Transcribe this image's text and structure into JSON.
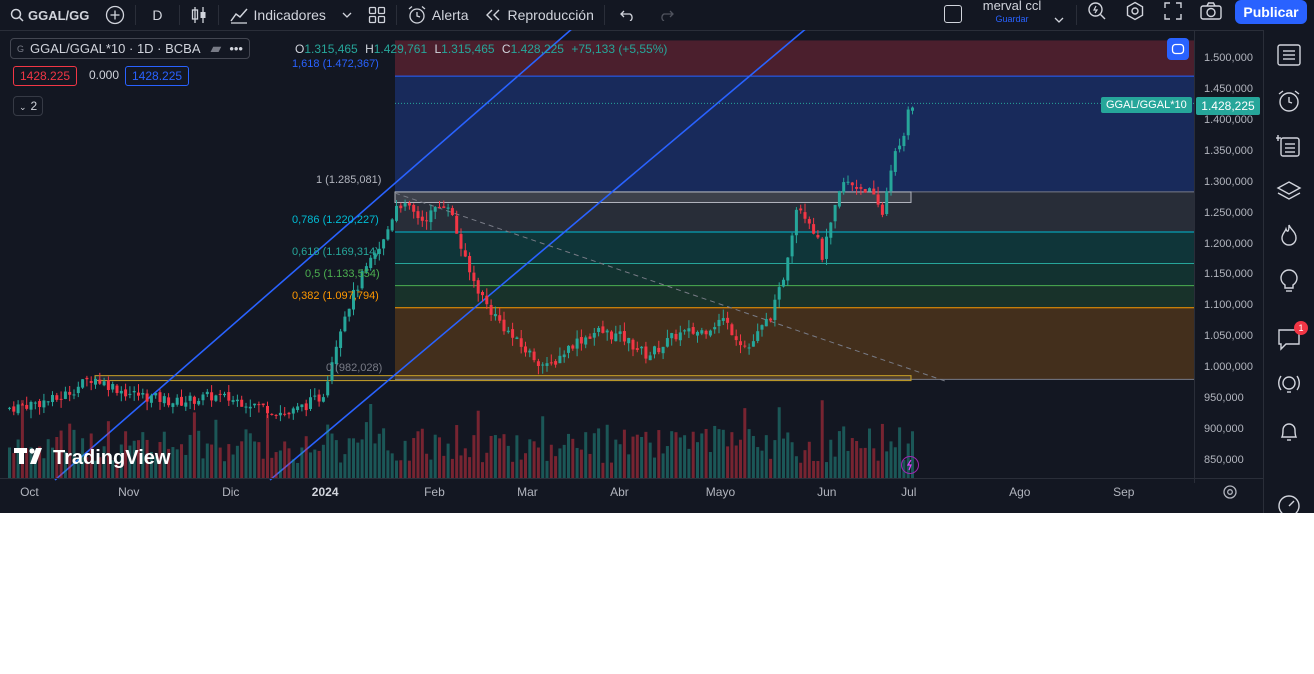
{
  "topbar": {
    "symbol": "GGAL/GG",
    "interval": "D",
    "indicators_label": "Indicadores",
    "alert_label": "Alerta",
    "replay_label": "Reproducción",
    "layout_name": "merval ccl",
    "layout_status": "Guardar",
    "publish_label": "Publicar"
  },
  "legend": {
    "symbol_full": "GGAL/GGAL*10 · 1D · BCBA",
    "bid": "1428.225",
    "spread": "0.000",
    "ask": "1428.225",
    "indicators_count": "2",
    "ohlc": {
      "o_label": "O",
      "o": "1.315,465",
      "h_label": "H",
      "h": "1.429,761",
      "l_label": "L",
      "l": "1.315,465",
      "c_label": "C",
      "c": "1.428,225",
      "change": "+75,133 (+5,55%)"
    }
  },
  "fib_labels": {
    "f1618": "1,618 (1.472,367)",
    "f1": "1 (1.285,081)",
    "f786": "0,786 (1.220,227)",
    "f618": "0,618 (1.169,314)",
    "f5": "0,5 (1.133,554)",
    "f382": "0,382 (1.097,794)",
    "f0": "0 (982,028)"
  },
  "price_axis": {
    "ticks": [
      "1.500,000",
      "1.450,000",
      "1.400,000",
      "1.350,000",
      "1.300,000",
      "1.250,000",
      "1.200,000",
      "1.150,000",
      "1.100,000",
      "1.050,000",
      "1.000,000",
      "950,000",
      "900,000",
      "850,000"
    ],
    "current_label": "GGAL/GGAL*10",
    "current_price": "1.428,225"
  },
  "time_axis": {
    "months": [
      "Oct",
      "Nov",
      "Dic",
      "2024",
      "Feb",
      "Mar",
      "Abr",
      "Mayo",
      "Jun",
      "Jul",
      "Ago",
      "Sep"
    ]
  },
  "branding": {
    "logo_text": "TradingView"
  },
  "colors": {
    "up": "#26a69a",
    "down": "#f23645",
    "accent": "#2962ff",
    "background": "#131722"
  },
  "chart_data": {
    "type": "candlestick",
    "series": [
      {
        "name": "GGAL/GGAL*10",
        "period": "Oct 2023 – Jul 2024",
        "close_samples": [
          {
            "x": "2023-10",
            "y": 940
          },
          {
            "x": "2023-11",
            "y": 960
          },
          {
            "x": "2023-12",
            "y": 930
          },
          {
            "x": "2024-01",
            "y": 1180
          },
          {
            "x": "2024-01-25",
            "y": 1270
          },
          {
            "x": "2024-02",
            "y": 1250
          },
          {
            "x": "2024-02-15",
            "y": 1100
          },
          {
            "x": "2024-03",
            "y": 1010
          },
          {
            "x": "2024-04",
            "y": 1040
          },
          {
            "x": "2024-05",
            "y": 1050
          },
          {
            "x": "2024-05-20",
            "y": 1260
          },
          {
            "x": "2024-06",
            "y": 1230
          },
          {
            "x": "2024-06-20",
            "y": 1290
          },
          {
            "x": "2024-07-01",
            "y": 1428.225
          }
        ]
      }
    ],
    "ylim": [
      820,
      1530
    ],
    "fibonacci_levels": [
      {
        "ratio": 1.618,
        "value": 1472.367
      },
      {
        "ratio": 1,
        "value": 1285.081
      },
      {
        "ratio": 0.786,
        "value": 1220.227
      },
      {
        "ratio": 0.618,
        "value": 1169.314
      },
      {
        "ratio": 0.5,
        "value": 1133.554
      },
      {
        "ratio": 0.382,
        "value": 1097.794
      },
      {
        "ratio": 0,
        "value": 982.028
      }
    ]
  }
}
